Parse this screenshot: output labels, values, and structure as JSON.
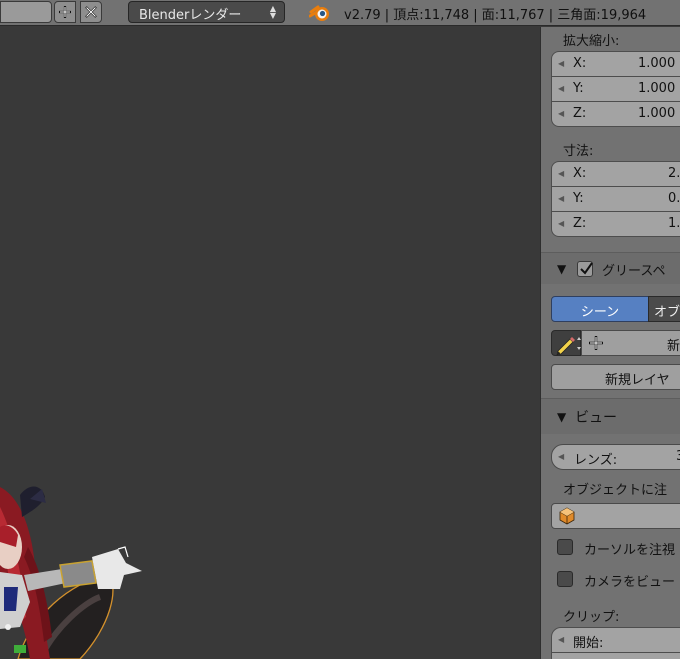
{
  "header": {
    "add_icon": "plus-icon",
    "remove_icon": "x-icon",
    "render_engine": "Blenderレンダー",
    "stats": "v2.79 | 頂点:11,748 | 面:11,767 | 三角面:19,964"
  },
  "panel": {
    "scale": {
      "label": "拡大縮小:",
      "rows": [
        {
          "axis": "X:",
          "value": "1.000"
        },
        {
          "axis": "Y:",
          "value": "1.000"
        },
        {
          "axis": "Z:",
          "value": "1.000"
        }
      ]
    },
    "dimensions": {
      "label": "寸法:",
      "rows": [
        {
          "axis": "X:",
          "value": "2."
        },
        {
          "axis": "Y:",
          "value": "0."
        },
        {
          "axis": "Z:",
          "value": "1."
        }
      ]
    },
    "grease_pencil": {
      "title": "グリースペ",
      "enabled": true,
      "tab_scene": "シーン",
      "tab_object": "オブ",
      "new_label": "新",
      "new_layer": "新規レイヤ"
    },
    "view": {
      "title": "ビュー",
      "lens_label": "レンズ:",
      "lens_value": "3",
      "lock_object_label": "オブジェクトに注",
      "lock_cursor": "カーソルを注視",
      "lock_camera": "カメラをビュー",
      "clip_label": "クリップ:",
      "clip_start_label": "開始:"
    }
  },
  "colors": {
    "header_bg": "#727272",
    "viewport_bg": "#393939",
    "panel_bg": "#727272",
    "accent": "#5680c2"
  }
}
